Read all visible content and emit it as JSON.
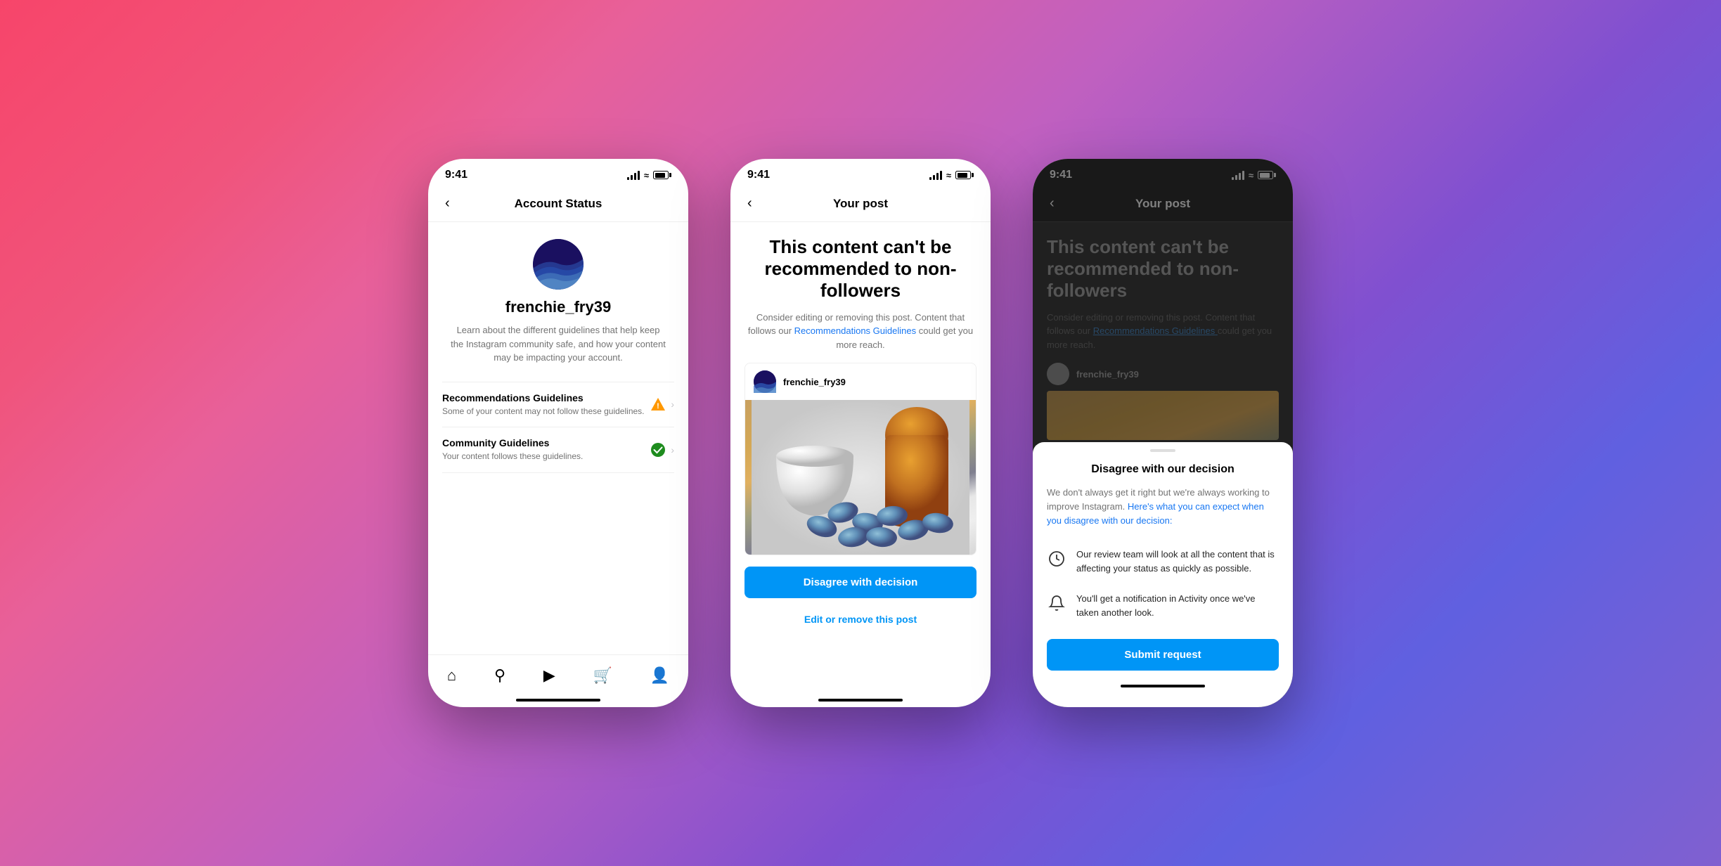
{
  "phone1": {
    "status_bar": {
      "time": "9:41"
    },
    "nav": {
      "title": "Account Status"
    },
    "profile": {
      "username": "frenchie_fry39",
      "description": "Learn about the different guidelines that help keep the Instagram community safe, and how your content may be impacting your account."
    },
    "guidelines": [
      {
        "title": "Recommendations Guidelines",
        "subtitle": "Some of your content may not follow these guidelines.",
        "status": "warning"
      },
      {
        "title": "Community Guidelines",
        "subtitle": "Your content follows these guidelines.",
        "status": "ok"
      }
    ],
    "bottom_nav": [
      "home",
      "search",
      "reels",
      "shop",
      "profile"
    ]
  },
  "phone2": {
    "status_bar": {
      "time": "9:41"
    },
    "nav": {
      "title": "Your post"
    },
    "warning": {
      "title": "This content can't be recommended to non-followers",
      "description": "Consider editing or removing this post. Content that follows our",
      "link_text": "Recommendations Guidelines",
      "description_end": "could get you more reach."
    },
    "post": {
      "username": "frenchie_fry39"
    },
    "buttons": {
      "disagree": "Disagree with decision",
      "edit_remove": "Edit or remove this post"
    }
  },
  "phone3": {
    "status_bar": {
      "time": "9:41"
    },
    "nav": {
      "title": "Your post"
    },
    "warning": {
      "title": "This content can't be recommended to non-followers",
      "description": "Consider editing or removing this post. Content that follows our",
      "link_text": "Recommendations Guidelines",
      "description_end": "could get you more reach."
    },
    "post": {
      "username": "frenchie_fry39"
    },
    "sheet": {
      "title": "Disagree with our decision",
      "description": "We don't always get it right but we're always working to improve Instagram.",
      "link_text": "Here's what you can expect when you disagree with our decision:",
      "items": [
        {
          "icon": "clock",
          "text": "Our review team will look at all the content that is affecting your status as quickly as possible."
        },
        {
          "icon": "bell",
          "text": "You'll get a notification in Activity once we've taken another look."
        }
      ],
      "submit_button": "Submit request"
    }
  }
}
